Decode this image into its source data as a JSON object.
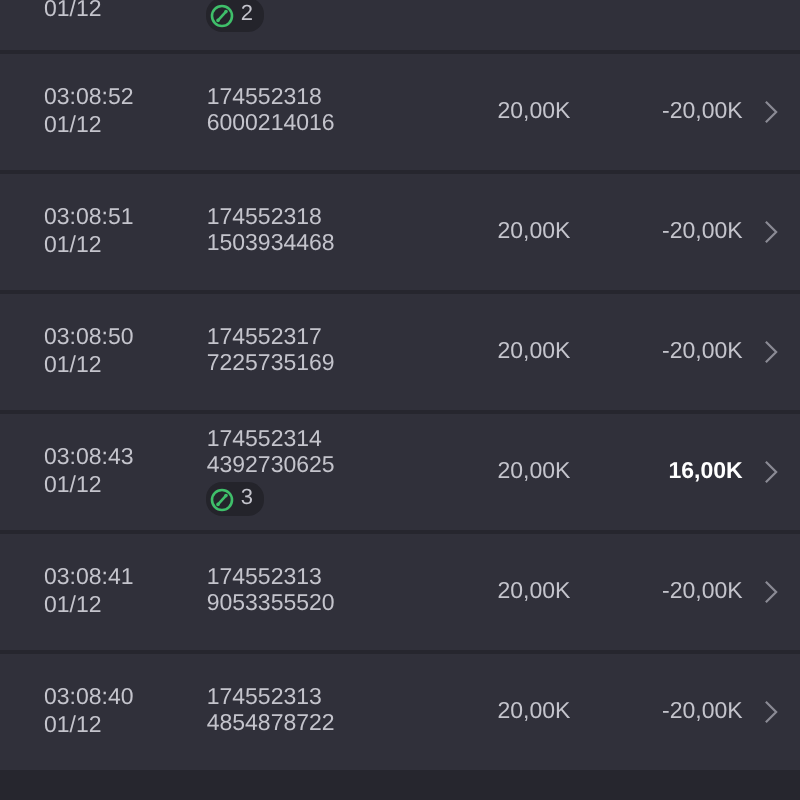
{
  "rows": [
    {
      "date": "01/12",
      "badge": "2"
    },
    {
      "time": "03:08:52",
      "date": "01/12",
      "order": "174552318",
      "ref": "6000214016",
      "amount": "20,00K",
      "result": "-20,00K",
      "highlight": false,
      "chevron": true
    },
    {
      "time": "03:08:51",
      "date": "01/12",
      "order": "174552318",
      "ref": "1503934468",
      "amount": "20,00K",
      "result": "-20,00K",
      "highlight": false,
      "chevron": true
    },
    {
      "time": "03:08:50",
      "date": "01/12",
      "order": "174552317",
      "ref": "7225735169",
      "amount": "20,00K",
      "result": "-20,00K",
      "highlight": false,
      "chevron": true
    },
    {
      "time": "03:08:43",
      "date": "01/12",
      "order": "174552314",
      "ref": "4392730625",
      "badge": "3",
      "amount": "20,00K",
      "result": "16,00K",
      "highlight": true,
      "chevron": true
    },
    {
      "time": "03:08:41",
      "date": "01/12",
      "order": "174552313",
      "ref": "9053355520",
      "amount": "20,00K",
      "result": "-20,00K",
      "highlight": false,
      "chevron": true
    },
    {
      "time": "03:08:40",
      "date": "01/12",
      "order": "174552313",
      "ref": "4854878722",
      "amount": "20,00K",
      "result": "-20,00K",
      "highlight": false,
      "chevron": true
    }
  ]
}
